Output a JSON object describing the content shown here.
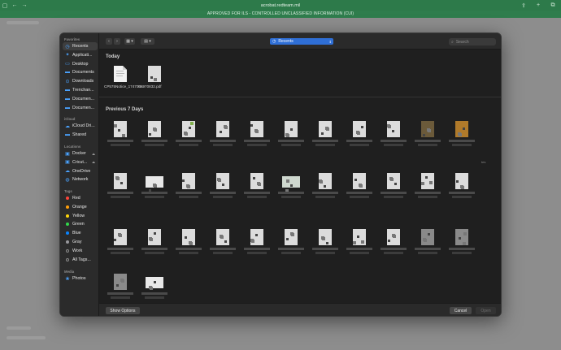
{
  "browser": {
    "url": "acrobat.redteam.mil",
    "banner": "APPROVED FOR ILS - CONTROLLED UNCLASSIFIED INFORMATION (CUI)"
  },
  "sidebar": {
    "favorites_label": "Favorites",
    "favorites": [
      {
        "label": "Recents",
        "icon": "clock-icon",
        "selected": true
      },
      {
        "label": "Applicati...",
        "icon": "apps-icon"
      },
      {
        "label": "Desktop",
        "icon": "desktop-icon"
      },
      {
        "label": "Documents",
        "icon": "folder-icon"
      },
      {
        "label": "Downloads",
        "icon": "download-icon"
      },
      {
        "label": "Trenchan...",
        "icon": "folder-icon"
      },
      {
        "label": "Documen...",
        "icon": "folder-icon"
      },
      {
        "label": "Documen...",
        "icon": "folder-icon"
      }
    ],
    "icloud_label": "iCloud",
    "icloud": [
      {
        "label": "iCloud Dri...",
        "icon": "cloud-icon"
      },
      {
        "label": "Shared",
        "icon": "shared-folder-icon"
      }
    ],
    "locations_label": "Locations",
    "locations": [
      {
        "label": "Docker",
        "icon": "disk-icon"
      },
      {
        "label": "Cricut...",
        "icon": "disk-icon"
      },
      {
        "label": "OneDrive",
        "icon": "cloud-icon"
      },
      {
        "label": "Network",
        "icon": "globe-icon"
      }
    ],
    "tags_label": "Tags",
    "tags": [
      {
        "label": "Red",
        "color": "#ff453a"
      },
      {
        "label": "Orange",
        "color": "#ff9f0a"
      },
      {
        "label": "Yellow",
        "color": "#ffd60a"
      },
      {
        "label": "Green",
        "color": "#32d74b"
      },
      {
        "label": "Blue",
        "color": "#0a84ff"
      },
      {
        "label": "Gray",
        "color": "#98989d"
      },
      {
        "label": "Work",
        "color": "#2b2b2b"
      },
      {
        "label": "All Tags...",
        "color": "#2b2b2b"
      }
    ],
    "media_label": "Media",
    "media": [
      {
        "label": "Photos",
        "icon": "photos-icon"
      }
    ]
  },
  "toolbar": {
    "back_icon": "‹",
    "forward_icon": "›",
    "view_icon": "▦ ▾",
    "group_icon": "▤ ▾",
    "location": "Recents",
    "search_placeholder": "Search"
  },
  "content": {
    "today_label": "Today",
    "today_files": [
      {
        "name": "CP575Notice_1747058970832.pdf"
      },
      {
        "name": "O..."
      }
    ],
    "previous_label": "Previous 7 Days",
    "right_tab": "tes"
  },
  "footer": {
    "show_options": "Show Options",
    "cancel": "Cancel",
    "open": "Open"
  }
}
